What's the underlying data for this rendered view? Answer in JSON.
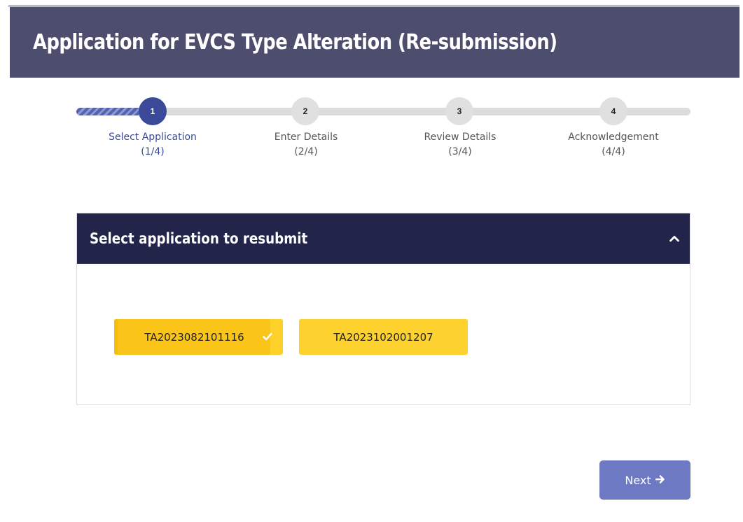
{
  "header": {
    "title": "Application for EVCS Type Alteration (Re-submission)"
  },
  "stepper": {
    "steps": [
      {
        "number": "1",
        "label": "Select Application",
        "fraction": "(1/4)",
        "state": "active"
      },
      {
        "number": "2",
        "label": "Enter Details",
        "fraction": "(2/4)",
        "state": "pending"
      },
      {
        "number": "3",
        "label": "Review Details",
        "fraction": "(3/4)",
        "state": "pending"
      },
      {
        "number": "4",
        "label": "Acknowledgement",
        "fraction": "(4/4)",
        "state": "pending"
      }
    ]
  },
  "panel": {
    "title": "Select application to resubmit",
    "collapse_icon": "chevron-up-icon",
    "applications": [
      {
        "id": "TA2023082101116",
        "selected": true,
        "icon": "check-icon"
      },
      {
        "id": "TA2023102001207",
        "selected": false
      }
    ]
  },
  "actions": {
    "next_label": "Next",
    "next_icon": "arrow-right-icon"
  },
  "colors": {
    "header_bg": "#4d4d6e",
    "panel_header_bg": "#22244a",
    "active_step": "#3a4a99",
    "app_button": "#fdd22e",
    "next_button": "#6e79c4"
  }
}
